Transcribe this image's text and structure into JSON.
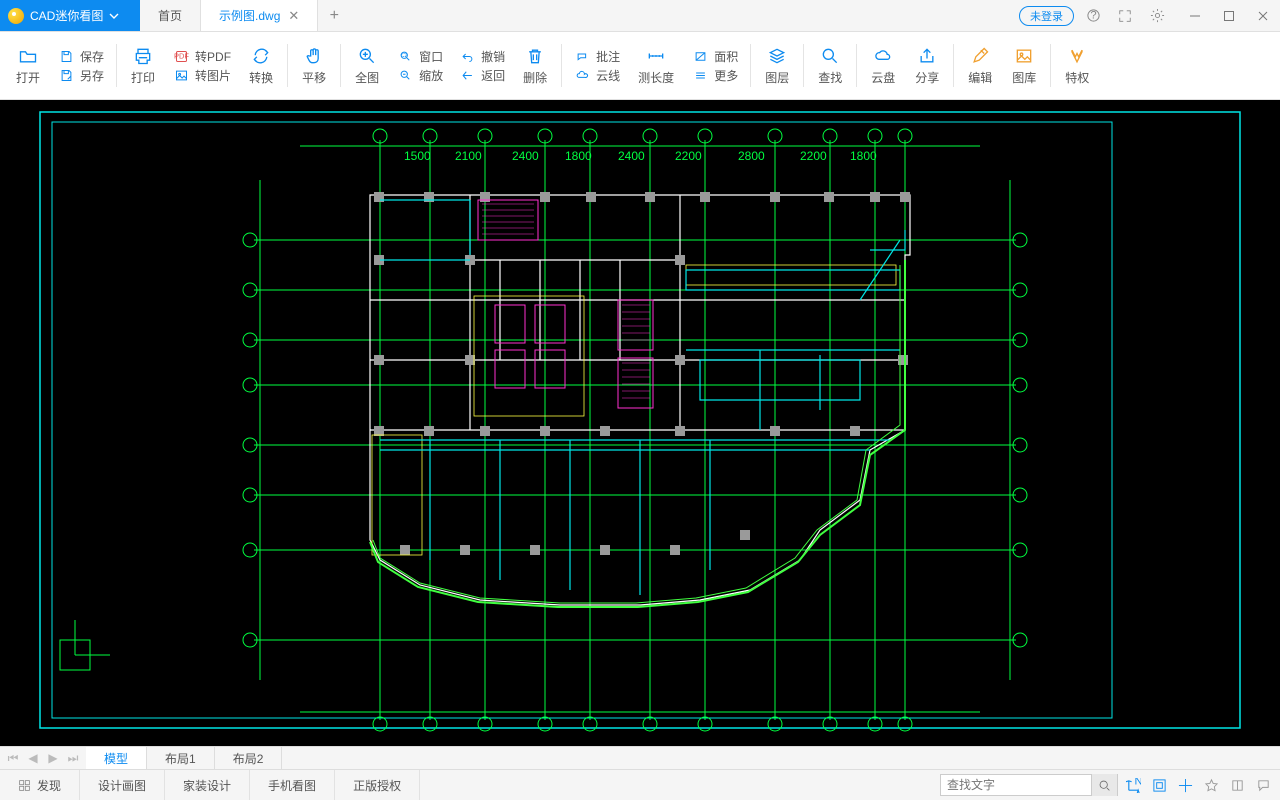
{
  "app": {
    "name": "CAD迷你看图"
  },
  "tabs": {
    "home": "首页",
    "file": "示例图.dwg"
  },
  "login": {
    "label": "未登录"
  },
  "toolbar": {
    "open": "打开",
    "save": "保存",
    "saveas": "另存",
    "print": "打印",
    "topdf": "转PDF",
    "toimage": "转图片",
    "convert": "转换",
    "pan": "平移",
    "full": "全图",
    "window": "窗口",
    "zoom": "缩放",
    "undo": "撤销",
    "back": "返回",
    "delete": "删除",
    "annotate": "批注",
    "cloud": "云线",
    "measure": "测长度",
    "area": "面积",
    "more": "更多",
    "layers": "图层",
    "find": "查找",
    "clouddisk": "云盘",
    "share": "分享",
    "edit": "编辑",
    "library": "图库",
    "vip": "特权"
  },
  "layout": {
    "model": "模型",
    "l1": "布局1",
    "l2": "布局2"
  },
  "status": {
    "discover": "发现",
    "design": "设计画图",
    "home": "家装设计",
    "mobile": "手机看图",
    "license": "正版授权"
  },
  "search": {
    "placeholder": "查找文字"
  }
}
